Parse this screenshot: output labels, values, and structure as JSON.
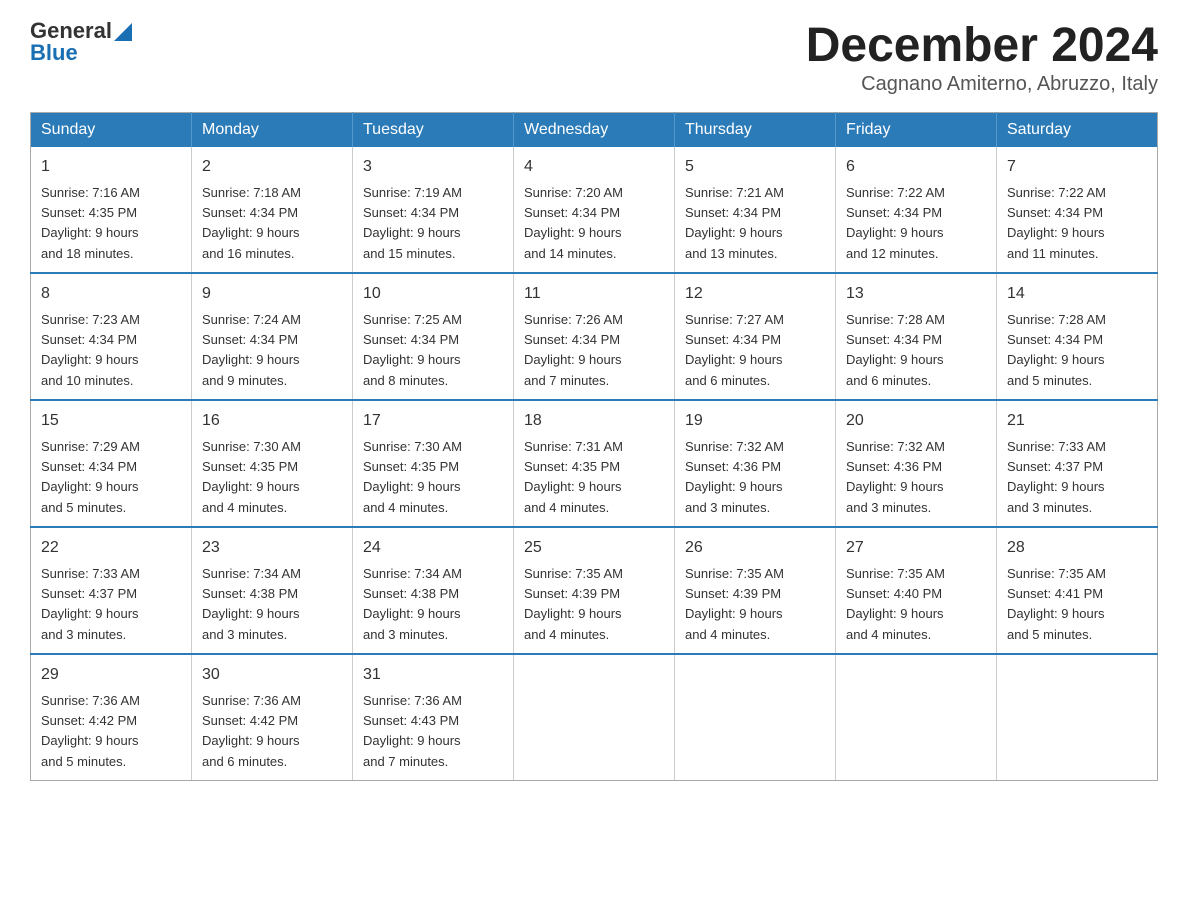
{
  "header": {
    "logo_general": "General",
    "logo_blue": "Blue",
    "title": "December 2024",
    "subtitle": "Cagnano Amiterno, Abruzzo, Italy"
  },
  "weekdays": [
    "Sunday",
    "Monday",
    "Tuesday",
    "Wednesday",
    "Thursday",
    "Friday",
    "Saturday"
  ],
  "weeks": [
    [
      {
        "day": "1",
        "sunrise": "7:16 AM",
        "sunset": "4:35 PM",
        "daylight": "9 hours and 18 minutes."
      },
      {
        "day": "2",
        "sunrise": "7:18 AM",
        "sunset": "4:34 PM",
        "daylight": "9 hours and 16 minutes."
      },
      {
        "day": "3",
        "sunrise": "7:19 AM",
        "sunset": "4:34 PM",
        "daylight": "9 hours and 15 minutes."
      },
      {
        "day": "4",
        "sunrise": "7:20 AM",
        "sunset": "4:34 PM",
        "daylight": "9 hours and 14 minutes."
      },
      {
        "day": "5",
        "sunrise": "7:21 AM",
        "sunset": "4:34 PM",
        "daylight": "9 hours and 13 minutes."
      },
      {
        "day": "6",
        "sunrise": "7:22 AM",
        "sunset": "4:34 PM",
        "daylight": "9 hours and 12 minutes."
      },
      {
        "day": "7",
        "sunrise": "7:22 AM",
        "sunset": "4:34 PM",
        "daylight": "9 hours and 11 minutes."
      }
    ],
    [
      {
        "day": "8",
        "sunrise": "7:23 AM",
        "sunset": "4:34 PM",
        "daylight": "9 hours and 10 minutes."
      },
      {
        "day": "9",
        "sunrise": "7:24 AM",
        "sunset": "4:34 PM",
        "daylight": "9 hours and 9 minutes."
      },
      {
        "day": "10",
        "sunrise": "7:25 AM",
        "sunset": "4:34 PM",
        "daylight": "9 hours and 8 minutes."
      },
      {
        "day": "11",
        "sunrise": "7:26 AM",
        "sunset": "4:34 PM",
        "daylight": "9 hours and 7 minutes."
      },
      {
        "day": "12",
        "sunrise": "7:27 AM",
        "sunset": "4:34 PM",
        "daylight": "9 hours and 6 minutes."
      },
      {
        "day": "13",
        "sunrise": "7:28 AM",
        "sunset": "4:34 PM",
        "daylight": "9 hours and 6 minutes."
      },
      {
        "day": "14",
        "sunrise": "7:28 AM",
        "sunset": "4:34 PM",
        "daylight": "9 hours and 5 minutes."
      }
    ],
    [
      {
        "day": "15",
        "sunrise": "7:29 AM",
        "sunset": "4:34 PM",
        "daylight": "9 hours and 5 minutes."
      },
      {
        "day": "16",
        "sunrise": "7:30 AM",
        "sunset": "4:35 PM",
        "daylight": "9 hours and 4 minutes."
      },
      {
        "day": "17",
        "sunrise": "7:30 AM",
        "sunset": "4:35 PM",
        "daylight": "9 hours and 4 minutes."
      },
      {
        "day": "18",
        "sunrise": "7:31 AM",
        "sunset": "4:35 PM",
        "daylight": "9 hours and 4 minutes."
      },
      {
        "day": "19",
        "sunrise": "7:32 AM",
        "sunset": "4:36 PM",
        "daylight": "9 hours and 3 minutes."
      },
      {
        "day": "20",
        "sunrise": "7:32 AM",
        "sunset": "4:36 PM",
        "daylight": "9 hours and 3 minutes."
      },
      {
        "day": "21",
        "sunrise": "7:33 AM",
        "sunset": "4:37 PM",
        "daylight": "9 hours and 3 minutes."
      }
    ],
    [
      {
        "day": "22",
        "sunrise": "7:33 AM",
        "sunset": "4:37 PM",
        "daylight": "9 hours and 3 minutes."
      },
      {
        "day": "23",
        "sunrise": "7:34 AM",
        "sunset": "4:38 PM",
        "daylight": "9 hours and 3 minutes."
      },
      {
        "day": "24",
        "sunrise": "7:34 AM",
        "sunset": "4:38 PM",
        "daylight": "9 hours and 3 minutes."
      },
      {
        "day": "25",
        "sunrise": "7:35 AM",
        "sunset": "4:39 PM",
        "daylight": "9 hours and 4 minutes."
      },
      {
        "day": "26",
        "sunrise": "7:35 AM",
        "sunset": "4:39 PM",
        "daylight": "9 hours and 4 minutes."
      },
      {
        "day": "27",
        "sunrise": "7:35 AM",
        "sunset": "4:40 PM",
        "daylight": "9 hours and 4 minutes."
      },
      {
        "day": "28",
        "sunrise": "7:35 AM",
        "sunset": "4:41 PM",
        "daylight": "9 hours and 5 minutes."
      }
    ],
    [
      {
        "day": "29",
        "sunrise": "7:36 AM",
        "sunset": "4:42 PM",
        "daylight": "9 hours and 5 minutes."
      },
      {
        "day": "30",
        "sunrise": "7:36 AM",
        "sunset": "4:42 PM",
        "daylight": "9 hours and 6 minutes."
      },
      {
        "day": "31",
        "sunrise": "7:36 AM",
        "sunset": "4:43 PM",
        "daylight": "9 hours and 7 minutes."
      },
      null,
      null,
      null,
      null
    ]
  ],
  "colors": {
    "header_bg": "#2b7bb9",
    "border_blue": "#2b7bb9"
  }
}
